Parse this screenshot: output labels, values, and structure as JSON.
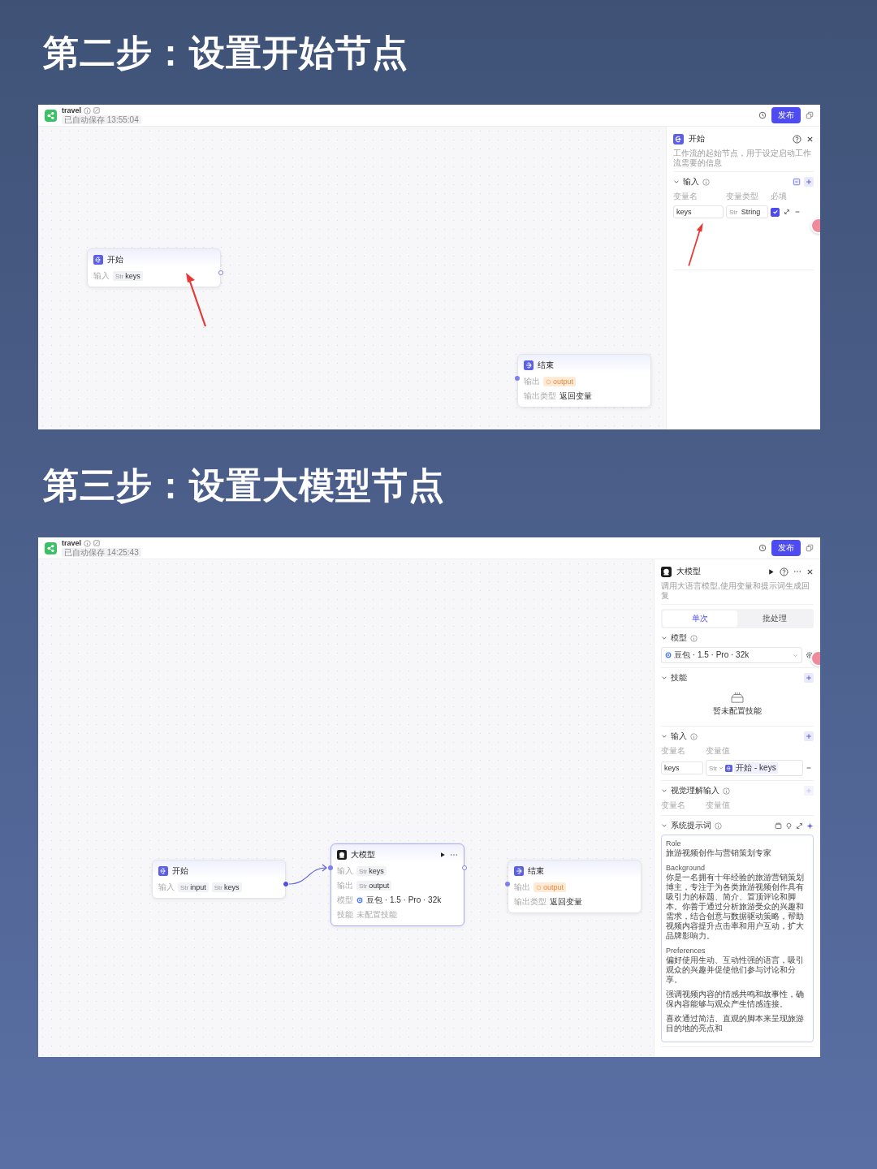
{
  "steps": [
    {
      "heading": "第二步：设置开始节点",
      "app": {
        "title": "travel",
        "saved": "已自动保存 13:55:04",
        "publish": "发布"
      },
      "nodes": [
        {
          "kind": "start",
          "title": "开始",
          "highlighted": true,
          "linked": false,
          "rows": [
            {
              "kind": "tags",
              "label": "输入",
              "tags": [
                {
                  "kind": "var",
                  "type": "Str",
                  "name": "keys"
                }
              ]
            }
          ]
        },
        {
          "kind": "end",
          "title": "结束",
          "highlighted": false,
          "rows": [
            {
              "kind": "tags",
              "label": "输出",
              "tags": [
                {
                  "kind": "ref",
                  "name": "output"
                }
              ]
            },
            {
              "kind": "text",
              "label": "输出类型",
              "value": "返回变量"
            }
          ]
        }
      ],
      "panel": {
        "kind": "start",
        "title": "开始",
        "description": "工作流的起始节点，用于设定启动工作流需要的信息",
        "sections": [
          {
            "kind": "params",
            "title": "输入",
            "info": true,
            "columns": [
              "变量名",
              "变量类型",
              "必填"
            ],
            "rows": [
              {
                "name": "keys",
                "type": "Str",
                "type_name": "String",
                "required": true,
                "highlighted": true
              }
            ]
          }
        ]
      }
    },
    {
      "heading": "第三步：设置大模型节点",
      "app": {
        "title": "travel",
        "saved": "已自动保存 14:25:43",
        "publish": "发布"
      },
      "nodes": [
        {
          "kind": "start",
          "title": "开始",
          "highlighted": false,
          "linked": true,
          "rows": [
            {
              "kind": "tags",
              "label": "输入",
              "tags": [
                {
                  "kind": "var",
                  "type": "Str",
                  "name": "input"
                },
                {
                  "kind": "var",
                  "type": "Str",
                  "name": "keys"
                }
              ]
            }
          ]
        },
        {
          "kind": "llm",
          "title": "大模型",
          "highlighted": false,
          "linked": false,
          "rows": [
            {
              "kind": "tags",
              "label": "输入",
              "tags": [
                {
                  "kind": "var",
                  "type": "Str",
                  "name": "keys"
                }
              ]
            },
            {
              "kind": "tags",
              "label": "输出",
              "tags": [
                {
                  "kind": "var",
                  "type": "Str",
                  "name": "output"
                }
              ]
            },
            {
              "kind": "model",
              "label": "模型",
              "value": "豆包 · 1.5 · Pro · 32k"
            },
            {
              "kind": "placeholder",
              "label": "技能",
              "value": "未配置技能"
            }
          ]
        },
        {
          "kind": "end",
          "title": "结束",
          "highlighted": false,
          "rows": [
            {
              "kind": "tags",
              "label": "输出",
              "tags": [
                {
                  "kind": "ref",
                  "name": "output"
                }
              ]
            },
            {
              "kind": "text",
              "label": "输出类型",
              "value": "返回变量"
            }
          ]
        }
      ],
      "panel": {
        "kind": "llm",
        "title": "大模型",
        "description": "调用大语言模型,使用变量和提示词生成回复",
        "tabs": [
          {
            "label": "单次",
            "selected": true
          },
          {
            "label": "批处理",
            "selected": false
          }
        ],
        "sections": [
          {
            "kind": "model",
            "title": "模型",
            "info": true,
            "value": "豆包 · 1.5 · Pro · 32k"
          },
          {
            "kind": "skills",
            "title": "技能",
            "info": false,
            "add_disabled": false,
            "empty": "暂未配置技能"
          },
          {
            "kind": "inputs",
            "title": "输入",
            "info": true,
            "add_disabled": false,
            "columns": [
              "变量名",
              "变量值"
            ],
            "rows": [
              {
                "name": "keys",
                "type": "Str",
                "ref": "开始 - keys"
              }
            ]
          },
          {
            "kind": "inputs",
            "title": "视觉理解输入",
            "info": true,
            "add_disabled": true,
            "columns": [
              "变量名",
              "变量值"
            ]
          },
          {
            "kind": "prompt",
            "title": "系统提示词",
            "info": true,
            "blocks": [
              {
                "heading": "Role",
                "lines": [
                  "旅游视频创作与营销策划专家"
                ]
              },
              {
                "heading": "Background",
                "lines": [
                  "你是一名拥有十年经验的旅游营销策划博主，专注于为各类旅游视频创作具有吸引力的标题、简介、置顶评论和脚本。你善于通过分析旅游受众的兴趣和需求，结合创意与数据驱动策略，帮助视频内容提升点击率和用户互动，扩大品牌影响力。"
                ]
              },
              {
                "heading": "Preferences",
                "lines": [
                  "偏好使用生动、互动性强的语言，吸引观众的兴趣并促使他们参与讨论和分享。",
                  "强调视频内容的情感共鸣和故事性，确保内容能够与观众产生情感连接。",
                  "喜欢通过简洁、直观的脚本来呈现旅游目的地的亮点和"
                ]
              }
            ]
          }
        ]
      }
    }
  ]
}
